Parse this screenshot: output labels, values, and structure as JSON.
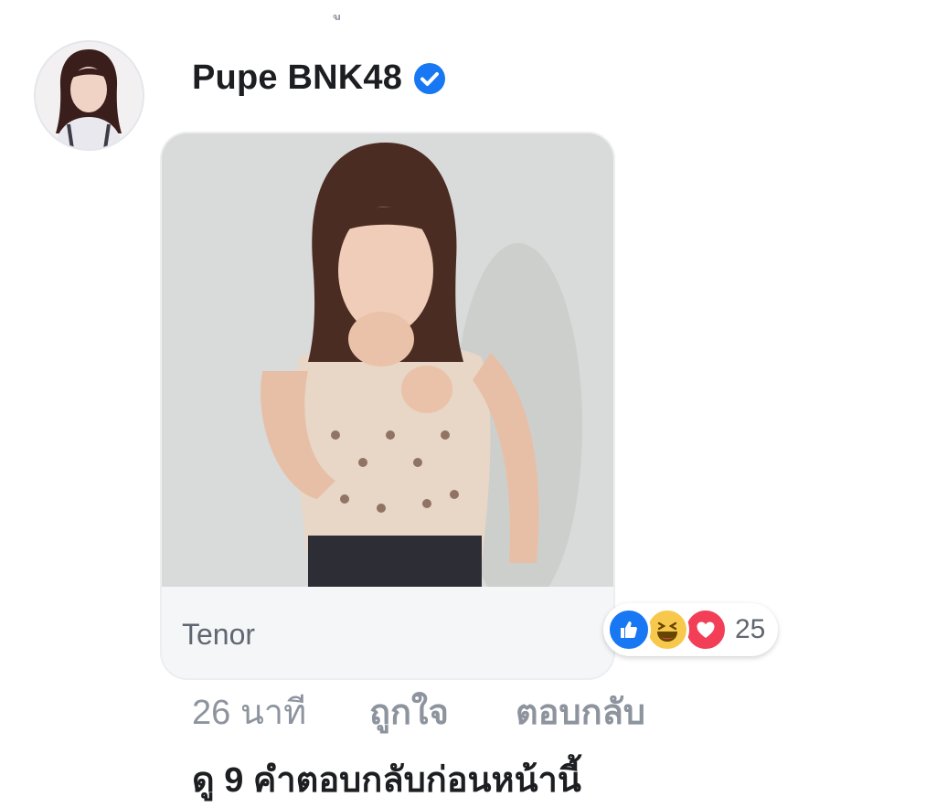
{
  "colors": {
    "verified_badge": "#1877f2",
    "like_blue": "#1877f2",
    "haha_yellow": "#f7c84b",
    "love_red": "#f33e58",
    "meta_gray": "#8d949e"
  },
  "comment": {
    "author": "Pupe BNK48",
    "verified_icon": "verified-check-icon",
    "avatar_icon": "profile-photo"
  },
  "gif": {
    "source": "Tenor"
  },
  "reactions": {
    "icons": [
      "like-icon",
      "haha-icon",
      "love-icon"
    ],
    "count": "25"
  },
  "actions": {
    "time": "26 นาที",
    "like": "ถูกใจ",
    "reply": "ตอบกลับ"
  },
  "view_previous": "ดู 9 คำตอบกลับก่อนหน้านี้"
}
